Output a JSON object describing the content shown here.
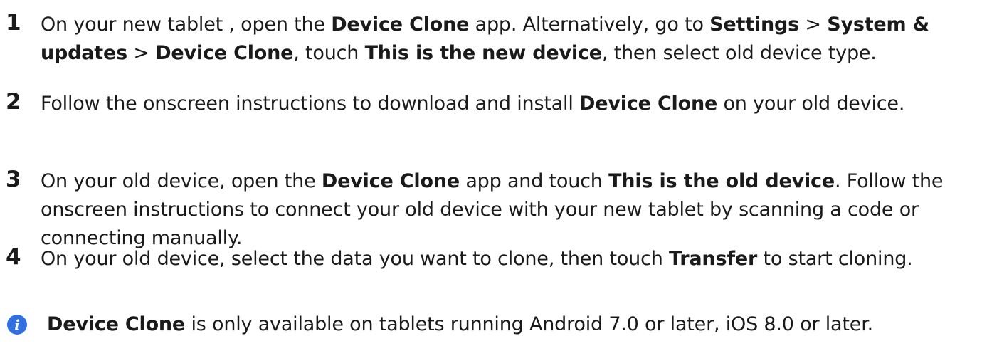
{
  "steps": [
    {
      "number": "1",
      "parts": [
        {
          "t": "On your new tablet , open the "
        },
        {
          "t": "Device Clone",
          "b": true
        },
        {
          "t": " app. Alternatively, go to "
        },
        {
          "t": "Settings",
          "b": true
        },
        {
          "t": " > "
        },
        {
          "t": "System & updates",
          "b": true
        },
        {
          "t": " > "
        },
        {
          "t": "Device Clone",
          "b": true
        },
        {
          "t": ", touch "
        },
        {
          "t": "This is the new device",
          "b": true
        },
        {
          "t": ", then select old device type."
        }
      ]
    },
    {
      "number": "2",
      "parts": [
        {
          "t": "Follow the onscreen instructions to download and install "
        },
        {
          "t": "Device Clone",
          "b": true
        },
        {
          "t": " on your old device."
        }
      ]
    },
    {
      "number": "3",
      "parts": [
        {
          "t": "On your old device, open the "
        },
        {
          "t": "Device Clone",
          "b": true
        },
        {
          "t": " app and touch "
        },
        {
          "t": "This is the old device",
          "b": true
        },
        {
          "t": ". Follow the onscreen instructions to connect your old device with your new tablet by scanning a code or connecting manually."
        }
      ]
    },
    {
      "number": "4",
      "parts": [
        {
          "t": "On your old device, select the data you want to clone, then touch "
        },
        {
          "t": "Transfer",
          "b": true
        },
        {
          "t": " to start cloning."
        }
      ]
    }
  ],
  "note": {
    "icon": "info-icon",
    "icon_color": "#2f6fe0",
    "parts": [
      {
        "t": "Device Clone",
        "b": true
      },
      {
        "t": " is only available on tablets running Android 7.0 or later, iOS 8.0 or later."
      }
    ]
  }
}
